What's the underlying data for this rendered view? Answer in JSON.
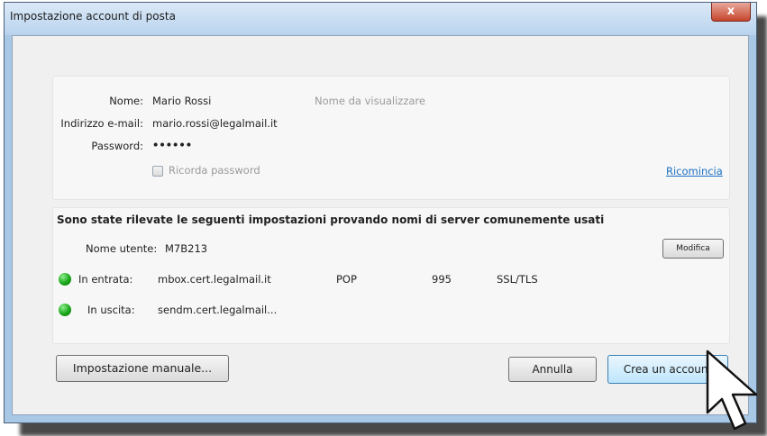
{
  "window": {
    "title": "Impostazione account di posta",
    "close_glyph": "x"
  },
  "account": {
    "name_label": "Nome:",
    "name_value": "Mario Rossi",
    "name_hint": "Nome da visualizzare",
    "email_label": "Indirizzo e-mail:",
    "email_value": "mario.rossi@legalmail.it",
    "password_label": "Password:",
    "password_value": "••••••",
    "remember_label": "Ricorda password",
    "restart_link": "Ricomincia"
  },
  "detection": {
    "heading": "Sono state rilevate le seguenti impostazioni provando nomi di server comunemente usati",
    "username_label": "Nome utente:",
    "username_value": "M7B213",
    "modify_button": "Modifica",
    "incoming": {
      "label": "In entrata:",
      "server": "mbox.cert.legalmail.it",
      "protocol": "POP",
      "port": "995",
      "security": "SSL/TLS",
      "status_color": "#19a519"
    },
    "outgoing": {
      "label": "In uscita:",
      "server": "sendm.cert.legalmail...",
      "status_color": "#19a519"
    }
  },
  "buttons": {
    "manual": "Impostazione manuale...",
    "cancel": "Annulla",
    "create": "Crea un account"
  },
  "icons": {
    "status": "green-status-icon",
    "cursor": "mouse-pointer-icon"
  }
}
